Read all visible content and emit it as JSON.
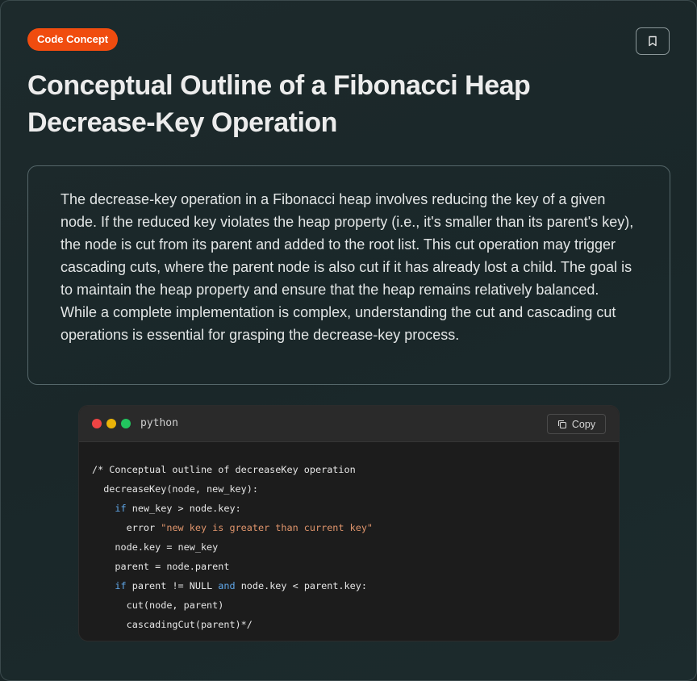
{
  "badge": "Code Concept",
  "title": "Conceptual Outline of a Fibonacci Heap Decrease-Key Operation",
  "description": "The decrease-key operation in a Fibonacci heap involves reducing the key of a given node. If the reduced key violates the heap property (i.e., it's smaller than its parent's key), the node is cut from its parent and added to the root list. This cut operation may trigger cascading cuts, where the parent node is also cut if it has already lost a child. The goal is to maintain the heap property and ensure that the heap remains relatively balanced. While a complete implementation is complex, understanding the cut and cascading cut operations is essential for grasping the decrease-key process.",
  "code_block": {
    "language": "python",
    "copy_label": "Copy",
    "lines": [
      [
        {
          "t": "/* Conceptual outline of decreaseKey operation"
        }
      ],
      [
        {
          "t": "  decreaseKey(node, new_key):"
        }
      ],
      [
        {
          "t": "    "
        },
        {
          "t": "if",
          "k": "kw"
        },
        {
          "t": " new_key > node.key:"
        }
      ],
      [
        {
          "t": "      error "
        },
        {
          "t": "\"new key is greater than current key\"",
          "k": "str"
        }
      ],
      [
        {
          "t": "    node.key = new_key"
        }
      ],
      [
        {
          "t": "    parent = node.parent"
        }
      ],
      [
        {
          "t": "    "
        },
        {
          "t": "if",
          "k": "kw"
        },
        {
          "t": " parent != NULL "
        },
        {
          "t": "and",
          "k": "kw"
        },
        {
          "t": " node.key < parent.key:"
        }
      ],
      [
        {
          "t": "      cut(node, parent)"
        }
      ],
      [
        {
          "t": "      cascadingCut(parent)*/"
        }
      ]
    ]
  },
  "icons": {
    "bookmark": "bookmark-icon",
    "copy": "copy-icon"
  },
  "colors": {
    "badge": "#f04c0f",
    "keyword": "#5fa6e8",
    "string": "#e0956c"
  }
}
